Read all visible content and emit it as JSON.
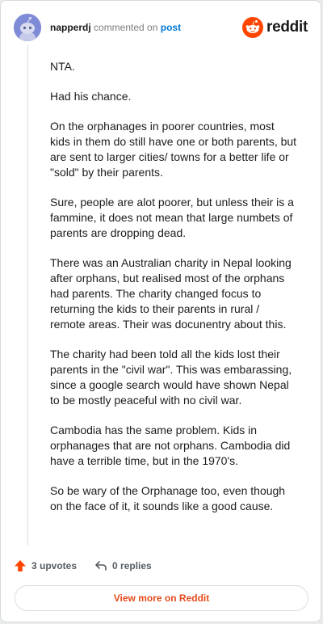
{
  "header": {
    "username": "napperdj",
    "commented_text": "commented on",
    "post_link": "post",
    "logo_text": "reddit"
  },
  "comment": {
    "paragraphs": [
      "NTA.",
      "Had his chance.",
      "On the orphanages in poorer countries, most kids in them do still have one or both parents, but are sent to larger cities/ towns for a better life or \"sold\" by their parents.",
      "Sure, people are alot poorer, but unless their is a fammine, it does not mean that large numbets of parents are dropping dead.",
      "There was an Australian charity in Nepal looking after orphans, but realised most of the orphans had parents. The charity changed focus to returning the kids to their parents in rural / remote areas. Their was docunentry about this.",
      "The charity had been told all the kids lost their parents in the \"civil war\". This was embarassing, since a google search would have shown Nepal to be mostly peaceful with no civil war.",
      "Cambodia has the same problem. Kids in orphanages that are not orphans. Cambodia did have a terrible time, but in the 1970's.",
      "So be wary of the Orphanage too, even though on the face of it, it sounds like a good cause."
    ]
  },
  "actions": {
    "upvotes_label": "3 upvotes",
    "replies_label": "0 replies"
  },
  "footer": {
    "view_more_label": "View more on Reddit"
  },
  "colors": {
    "brand": "#ff4500",
    "link": "#0079d3",
    "view_more": "#e44b1c"
  }
}
